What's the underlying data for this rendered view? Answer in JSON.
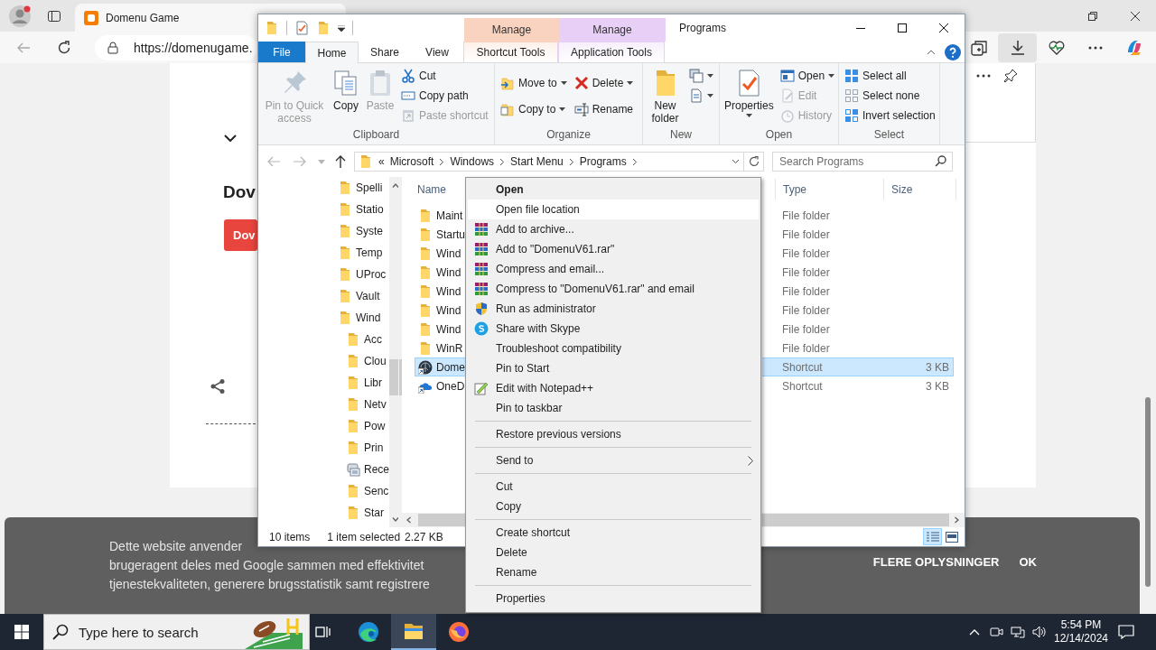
{
  "browser": {
    "tab_title": "Domenu Game",
    "url": "https://domenugame.",
    "page": {
      "heading": "Dov",
      "button": "Dov"
    },
    "cookie_banner": {
      "lines": [
        "Dette website anvender",
        "brugeragent deles med Google sammen med effektivitet",
        "tjenestekvaliteten, generere brugsstatistik samt registrere"
      ],
      "more_info": "FLERE OPLYSNINGER",
      "ok": "OK"
    }
  },
  "explorer": {
    "title": "Programs",
    "tabs": [
      {
        "label": "File",
        "kind": "file",
        "selected": false
      },
      {
        "label": "Home",
        "kind": "normal",
        "selected": true
      },
      {
        "label": "Share",
        "kind": "normal",
        "selected": false
      },
      {
        "label": "View",
        "kind": "normal",
        "selected": false
      },
      {
        "label": "Shortcut Tools",
        "kind": "contextual",
        "group": "Manage",
        "color": "#f9d3bf",
        "selected": false
      },
      {
        "label": "Application Tools",
        "kind": "contextual",
        "group": "Manage",
        "color": "#e8cff6",
        "selected": false
      }
    ],
    "ribbon": [
      {
        "label": "Clipboard",
        "items": [
          {
            "kind": "large",
            "label": "Pin to Quick access",
            "disabled": true,
            "dropdown": false
          },
          {
            "kind": "large",
            "label": "Copy",
            "disabled": false,
            "dropdown": false
          },
          {
            "kind": "large",
            "label": "Paste",
            "disabled": true,
            "dropdown": false
          },
          {
            "kind": "column",
            "items": [
              {
                "kind": "small",
                "label": "Cut",
                "disabled": false,
                "dropdown": false
              },
              {
                "kind": "small",
                "label": "Copy path",
                "disabled": false,
                "dropdown": false
              },
              {
                "kind": "small",
                "label": "Paste shortcut",
                "disabled": true,
                "dropdown": false
              }
            ]
          }
        ]
      },
      {
        "label": "Organize",
        "items": [
          {
            "kind": "column",
            "items": [
              {
                "kind": "small",
                "label": "Move to",
                "disabled": false,
                "dropdown": true
              },
              {
                "kind": "small",
                "label": "Copy to",
                "disabled": false,
                "dropdown": true
              }
            ]
          },
          {
            "kind": "column",
            "items": [
              {
                "kind": "small",
                "label": "Delete",
                "disabled": false,
                "dropdown": true
              },
              {
                "kind": "small",
                "label": "Rename",
                "disabled": false,
                "dropdown": false
              }
            ]
          }
        ]
      },
      {
        "label": "New",
        "items": [
          {
            "kind": "large",
            "label": "New folder",
            "disabled": false,
            "dropdown": false
          },
          {
            "kind": "column",
            "items": [
              {
                "kind": "icon",
                "disabled": false,
                "dropdown": true
              },
              {
                "kind": "icon",
                "disabled": false,
                "dropdown": true
              }
            ]
          }
        ]
      },
      {
        "label": "Open",
        "items": [
          {
            "kind": "large",
            "label": "Properties",
            "disabled": false,
            "dropdown": true
          },
          {
            "kind": "column",
            "items": [
              {
                "kind": "small",
                "label": "Open",
                "disabled": false,
                "dropdown": true
              },
              {
                "kind": "small",
                "label": "Edit",
                "disabled": true,
                "dropdown": false
              },
              {
                "kind": "small",
                "label": "History",
                "disabled": true,
                "dropdown": false
              }
            ]
          }
        ]
      },
      {
        "label": "Select",
        "items": [
          {
            "kind": "column",
            "items": [
              {
                "kind": "small",
                "label": "Select all",
                "disabled": false,
                "dropdown": false
              },
              {
                "kind": "small",
                "label": "Select none",
                "disabled": false,
                "dropdown": false
              },
              {
                "kind": "small",
                "label": "Invert selection",
                "disabled": false,
                "dropdown": false
              }
            ]
          }
        ]
      }
    ],
    "address": {
      "overflow": "«",
      "path": [
        "Microsoft",
        "Windows",
        "Start Menu",
        "Programs"
      ],
      "search_placeholder": "Search Programs"
    },
    "nav_tree": [
      {
        "label": "Spelli",
        "kind": "folder"
      },
      {
        "label": "Statio",
        "kind": "folder"
      },
      {
        "label": "Syste",
        "kind": "folder"
      },
      {
        "label": "Temp",
        "kind": "folder"
      },
      {
        "label": "UProc",
        "kind": "folder"
      },
      {
        "label": "Vault",
        "kind": "folder"
      },
      {
        "label": "Wind",
        "kind": "folder",
        "children": [
          {
            "label": "Acc",
            "kind": "folder"
          },
          {
            "label": "Clou",
            "kind": "folder"
          },
          {
            "label": "Libr",
            "kind": "folder"
          },
          {
            "label": "Netv",
            "kind": "folder"
          },
          {
            "label": "Pow",
            "kind": "folder"
          },
          {
            "label": "Prin",
            "kind": "folder"
          },
          {
            "label": "Rece",
            "kind": "recent"
          },
          {
            "label": "Senc",
            "kind": "folder"
          },
          {
            "label": "Star",
            "kind": "folder"
          }
        ]
      }
    ],
    "columns": [
      "Name",
      "Type",
      "Size"
    ],
    "files": [
      {
        "name": "Maint",
        "kind": "folder",
        "type": "File folder",
        "selected": false
      },
      {
        "name": "Startu",
        "kind": "folder",
        "type": "File folder",
        "selected": false
      },
      {
        "name": "Wind",
        "kind": "folder",
        "type": "File folder",
        "selected": false
      },
      {
        "name": "Wind",
        "kind": "folder",
        "type": "File folder",
        "selected": false
      },
      {
        "name": "Wind",
        "kind": "folder",
        "type": "File folder",
        "selected": false
      },
      {
        "name": "Wind",
        "kind": "folder",
        "type": "File folder",
        "selected": false
      },
      {
        "name": "Wind",
        "kind": "folder",
        "type": "File folder",
        "selected": false
      },
      {
        "name": "WinR",
        "kind": "folder",
        "type": "File folder",
        "selected": false
      },
      {
        "name": "Dome",
        "kind": "app",
        "type": "Shortcut",
        "size": "3 KB",
        "selected": true
      },
      {
        "name": "OneD",
        "kind": "cloud",
        "type": "Shortcut",
        "size": "3 KB",
        "selected": false
      }
    ],
    "status": {
      "count": "10 items",
      "selection": "1 item selected",
      "size": "2.27 KB"
    },
    "view_buttons": [
      {
        "kind": "details",
        "selected": true
      },
      {
        "kind": "tiles",
        "selected": false
      }
    ]
  },
  "context_menu": [
    {
      "label": "Open",
      "kind": "plain",
      "default": true,
      "selected": false
    },
    {
      "label": "Open file location",
      "kind": "plain",
      "default": false,
      "selected": true
    },
    {
      "label": "Add to archive...",
      "kind": "archive",
      "default": false,
      "selected": false
    },
    {
      "label": "Add to \"DomenuV61.rar\"",
      "kind": "archive",
      "default": false,
      "selected": false
    },
    {
      "label": "Compress and email...",
      "kind": "archive",
      "default": false,
      "selected": false
    },
    {
      "label": "Compress to \"DomenuV61.rar\" and email",
      "kind": "archive",
      "default": false,
      "selected": false
    },
    {
      "label": "Run as administrator",
      "kind": "admin",
      "default": false,
      "selected": false
    },
    {
      "label": "Share with Skype",
      "kind": "share",
      "default": false,
      "selected": false
    },
    {
      "label": "Troubleshoot compatibility",
      "kind": "plain",
      "default": false,
      "selected": false
    },
    {
      "label": "Pin to Start",
      "kind": "plain",
      "default": false,
      "selected": false
    },
    {
      "label": "Edit with Notepad++",
      "kind": "edit",
      "default": false,
      "selected": false
    },
    {
      "label": "Pin to taskbar",
      "kind": "plain",
      "default": false,
      "selected": false
    },
    {
      "kind": "separator"
    },
    {
      "label": "Restore previous versions",
      "kind": "plain",
      "default": false,
      "selected": false
    },
    {
      "kind": "separator"
    },
    {
      "label": "Send to",
      "kind": "submenu",
      "default": false,
      "selected": false
    },
    {
      "kind": "separator"
    },
    {
      "label": "Cut",
      "kind": "plain",
      "default": false,
      "selected": false
    },
    {
      "label": "Copy",
      "kind": "plain",
      "default": false,
      "selected": false
    },
    {
      "kind": "separator"
    },
    {
      "label": "Create shortcut",
      "kind": "plain",
      "default": false,
      "selected": false
    },
    {
      "label": "Delete",
      "kind": "plain",
      "default": false,
      "selected": false
    },
    {
      "label": "Rename",
      "kind": "plain",
      "default": false,
      "selected": false
    },
    {
      "kind": "separator"
    },
    {
      "label": "Properties",
      "kind": "plain",
      "default": false,
      "selected": false
    }
  ],
  "taskbar": {
    "search_placeholder": "Type here to search",
    "apps": [
      {
        "kind": "taskview",
        "selected": false
      },
      {
        "kind": "browser",
        "selected": false
      },
      {
        "kind": "files",
        "selected": true
      },
      {
        "kind": "firefox",
        "selected": false
      }
    ],
    "clock": {
      "time": "5:54 PM",
      "date": "12/14/2024"
    }
  }
}
